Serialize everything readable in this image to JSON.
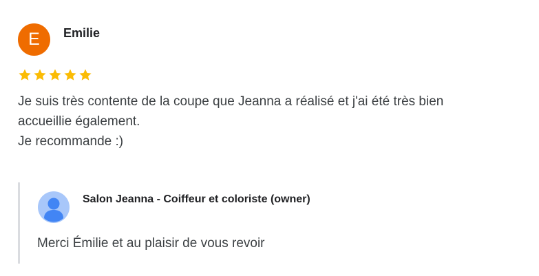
{
  "review": {
    "avatar_letter": "E",
    "avatar_color": "#ef6c00",
    "reviewer_name": "Emilie",
    "rating": 5,
    "max_rating": 5,
    "star_color": "#fbbc04",
    "text": "Je suis très contente de la coupe que Jeanna a réalisé et j'ai été très bien\naccueillie également.\nJe recommande :)"
  },
  "owner_reply": {
    "avatar_icon": "person-icon",
    "owner_name": "Salon Jeanna - Coiffeur et coloriste (owner)",
    "text": "Merci Émilie et au plaisir de vous revoir"
  }
}
